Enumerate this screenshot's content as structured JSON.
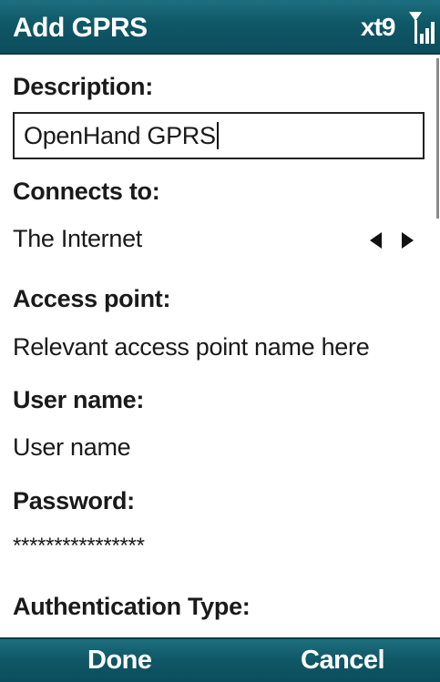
{
  "titlebar": {
    "title": "Add GPRS",
    "input_mode": "xt9",
    "signal_icon": "signal-strength-icon"
  },
  "form": {
    "description": {
      "label": "Description:",
      "value": "OpenHand GPRS"
    },
    "connects_to": {
      "label": "Connects to:",
      "value": "The Internet",
      "icon": "left-right-arrows-icon"
    },
    "access_point": {
      "label": "Access point:",
      "value": "Relevant access point name here"
    },
    "user_name": {
      "label": "User name:",
      "value": "User name"
    },
    "password": {
      "label": "Password:",
      "value": "****************"
    },
    "authentication_type": {
      "label": "Authentication Type:"
    }
  },
  "softkeys": {
    "left": "Done",
    "right": "Cancel"
  },
  "colors": {
    "bar": "#0f5767",
    "text": "#1a1a1a",
    "background": "#ffffff"
  }
}
